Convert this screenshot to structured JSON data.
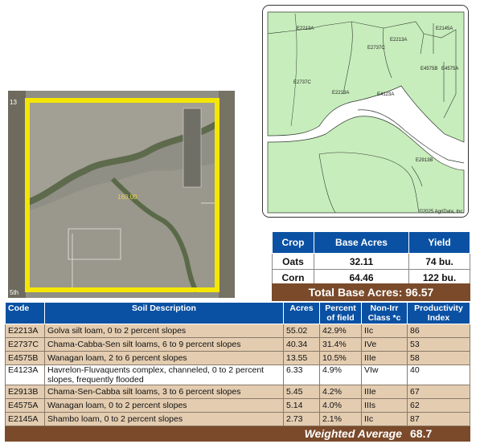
{
  "aerial": {
    "field_acres_label": "160.00",
    "corner_top_label": "13",
    "corner_bottom_label": "5th"
  },
  "soil_map": {
    "labels": [
      "E2213A",
      "E2145A",
      "E2213A",
      "E2737C",
      "E4575B",
      "E4575A",
      "E2737C",
      "E2213A",
      "E4123A",
      "E2913B"
    ],
    "copyright": "©2025 AgriData, Inc.",
    "fill_color": "#c8edbc"
  },
  "crop_table": {
    "headers": [
      "Crop",
      "Base Acres",
      "Yield"
    ],
    "rows": [
      {
        "crop": "Oats",
        "acres": "32.11",
        "yield": "74 bu."
      },
      {
        "crop": "Corn",
        "acres": "64.46",
        "yield": "122 bu."
      }
    ],
    "total": "Total Base Acres: 96.57"
  },
  "soil_table": {
    "headers": {
      "code": "Code",
      "desc": "Soil Description",
      "acres": "Acres",
      "pct": "Percent of field",
      "cls": "Non-Irr Class *c",
      "prod": "Productivity Index"
    },
    "rows": [
      {
        "code": "E2213A",
        "desc": "Golva silt loam, 0 to 2 percent slopes",
        "acres": "55.02",
        "pct": "42.9%",
        "cls": "IIc",
        "prod": "86"
      },
      {
        "code": "E2737C",
        "desc": "Chama-Cabba-Sen silt loams, 6 to 9 percent slopes",
        "acres": "40.34",
        "pct": "31.4%",
        "cls": "IVe",
        "prod": "53"
      },
      {
        "code": "E4575B",
        "desc": "Wanagan loam, 2 to 6 percent slopes",
        "acres": "13.55",
        "pct": "10.5%",
        "cls": "IIIe",
        "prod": "58"
      },
      {
        "code": "E4123A",
        "desc": "Havrelon-Fluvaquents complex, channeled, 0 to 2 percent slopes, frequently flooded",
        "acres": "6.33",
        "pct": "4.9%",
        "cls": "VIw",
        "prod": "40"
      },
      {
        "code": "E2913B",
        "desc": "Chama-Sen-Cabba silt loams, 3 to 6 percent slopes",
        "acres": "5.45",
        "pct": "4.2%",
        "cls": "IIIe",
        "prod": "67"
      },
      {
        "code": "E4575A",
        "desc": "Wanagan loam, 0 to 2 percent slopes",
        "acres": "5.14",
        "pct": "4.0%",
        "cls": "IIIs",
        "prod": "62"
      },
      {
        "code": "E2145A",
        "desc": "Shambo loam, 0 to 2 percent slopes",
        "acres": "2.73",
        "pct": "2.1%",
        "cls": "IIc",
        "prod": "87"
      }
    ],
    "weighted_average_label": "Weighted Average",
    "weighted_average_value": "68.7"
  }
}
